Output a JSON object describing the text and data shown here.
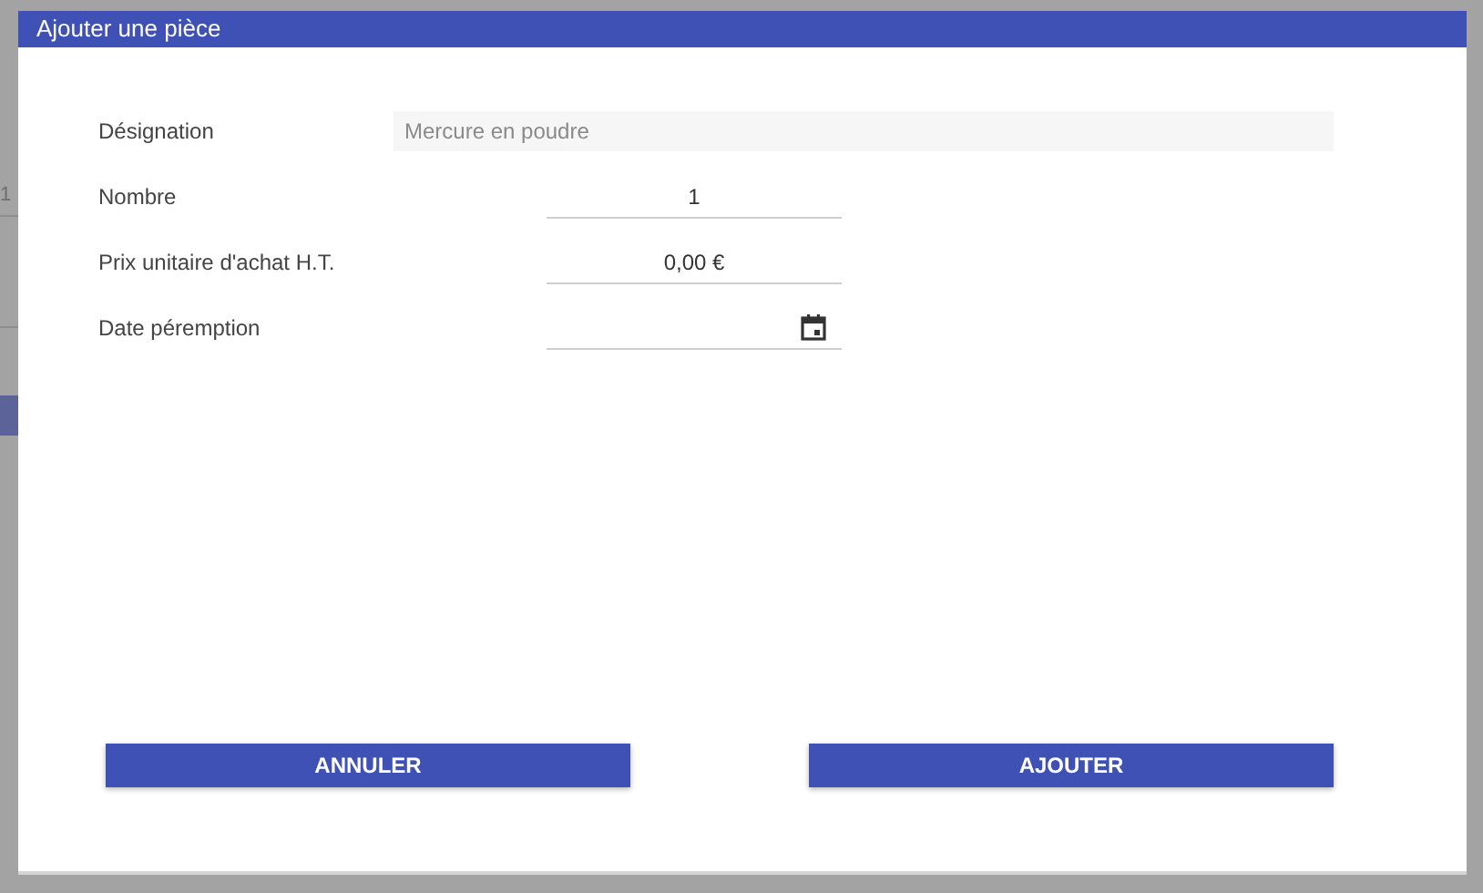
{
  "backdrop": {
    "cell_text": "1"
  },
  "dialog": {
    "title": "Ajouter une pièce",
    "fields": [
      {
        "kind": "readonly",
        "label": "Désignation",
        "value": "Mercure en poudre",
        "disabled": true
      },
      {
        "kind": "number",
        "label": "Nombre",
        "value": "1"
      },
      {
        "kind": "number",
        "label": "Prix unitaire d'achat H.T.",
        "value": "0,00 €"
      },
      {
        "kind": "date",
        "label": "Date péremption"
      }
    ],
    "buttons": [
      "ANNULER",
      "AJOUTER"
    ]
  }
}
